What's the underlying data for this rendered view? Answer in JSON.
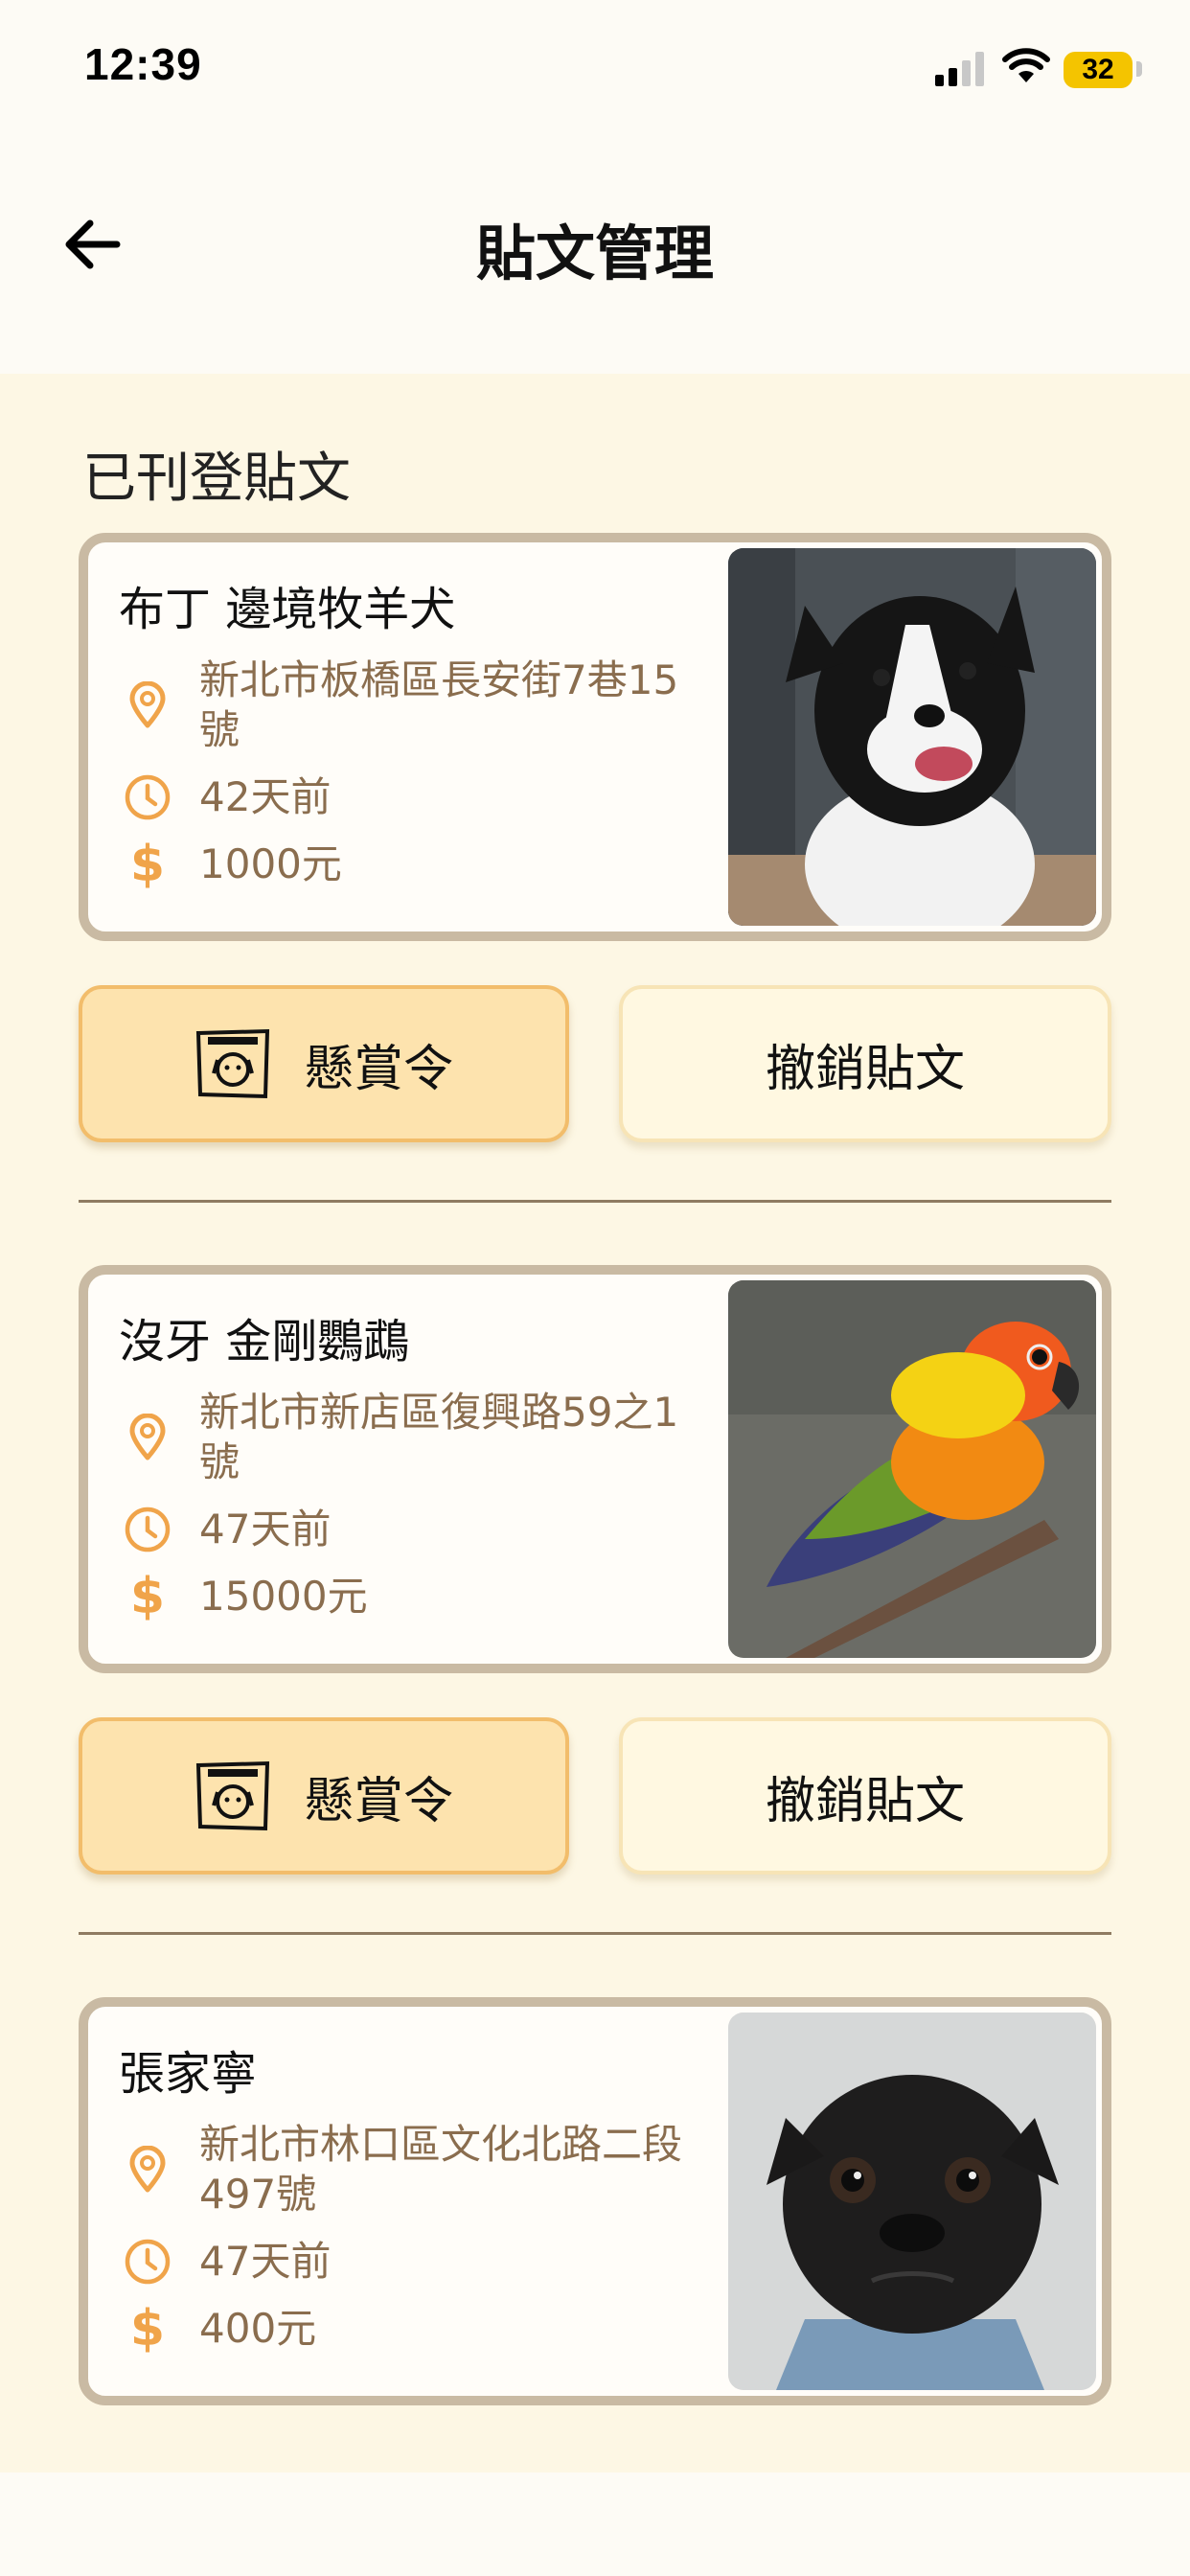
{
  "status_bar": {
    "time": "12:39",
    "battery": "32",
    "icons": [
      "signal-icon",
      "wifi-icon",
      "battery-icon"
    ]
  },
  "header": {
    "title": "貼文管理",
    "back_icon": "arrow-left-icon"
  },
  "section_title": "已刊登貼文",
  "posts": [
    {
      "name": "布丁 邊境牧羊犬",
      "address": "新北市板橋區長安街7巷15號",
      "time": "42天前",
      "price": "1000元",
      "photo": "border-collie-photo",
      "bounty_label": "懸賞令",
      "revoke_label": "撤銷貼文"
    },
    {
      "name": "沒牙 金剛鸚鵡",
      "address": "新北市新店區復興路59之1號",
      "time": "47天前",
      "price": "15000元",
      "photo": "parrot-photo",
      "bounty_label": "懸賞令",
      "revoke_label": "撤銷貼文"
    },
    {
      "name": "張家寧",
      "address": "新北市林口區文化北路二段497號",
      "time": "47天前",
      "price": "400元",
      "photo": "pug-photo"
    }
  ],
  "icon_names": {
    "location": "map-pin-icon",
    "time": "clock-icon",
    "price": "dollar-icon",
    "bounty": "wanted-poster-icon"
  },
  "colors": {
    "accent_orange": "#f0a44a",
    "info_text": "#8a6d4e",
    "card_border": "#c9baa3",
    "content_bg": "#fdf7e4",
    "bounty_bg": "#fde3ae",
    "revoke_bg": "#fff8e1",
    "battery": "#f4c400"
  }
}
